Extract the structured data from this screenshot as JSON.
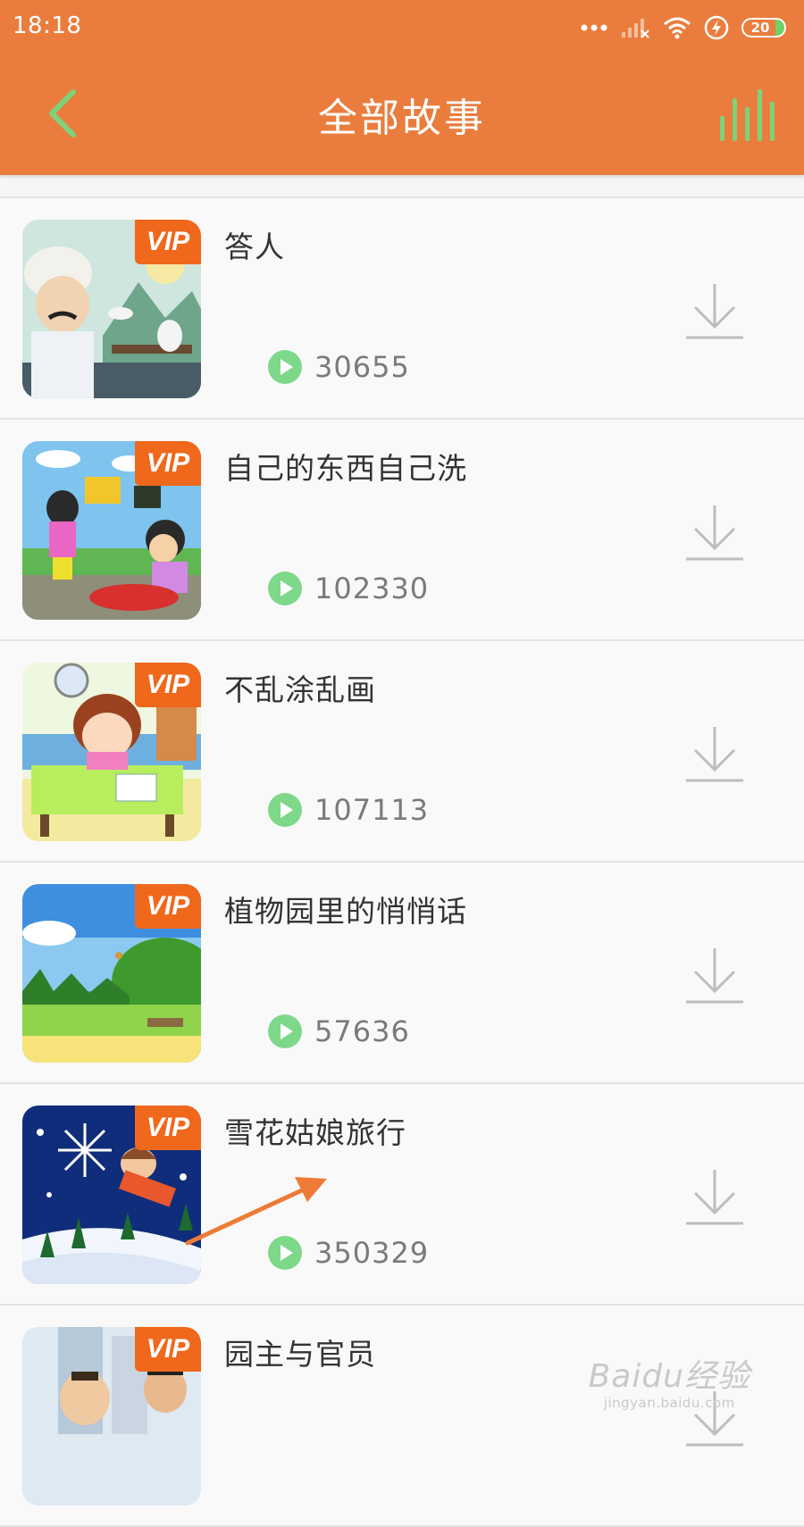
{
  "status_bar": {
    "time": "18:18",
    "battery": "20"
  },
  "header": {
    "title": "全部故事",
    "back_icon": "chevron-left-icon",
    "right_icon": "equalizer-icon"
  },
  "colors": {
    "header_bg": "#ea7d3d",
    "accent_green": "#7ed88a",
    "vip_orange": "#f0681c"
  },
  "vip_label": "VIP",
  "stories": [
    {
      "title": "答人",
      "plays": "30655",
      "vip": true
    },
    {
      "title": "自己的东西自己洗",
      "plays": "102330",
      "vip": true
    },
    {
      "title": "不乱涂乱画",
      "plays": "107113",
      "vip": true
    },
    {
      "title": "植物园里的悄悄话",
      "plays": "57636",
      "vip": true
    },
    {
      "title": "雪花姑娘旅行",
      "plays": "350329",
      "vip": true
    },
    {
      "title": "园主与官员",
      "plays": "",
      "vip": true
    }
  ],
  "watermark": {
    "logo": "Baidu经验",
    "url": "jingyan.baidu.com"
  }
}
